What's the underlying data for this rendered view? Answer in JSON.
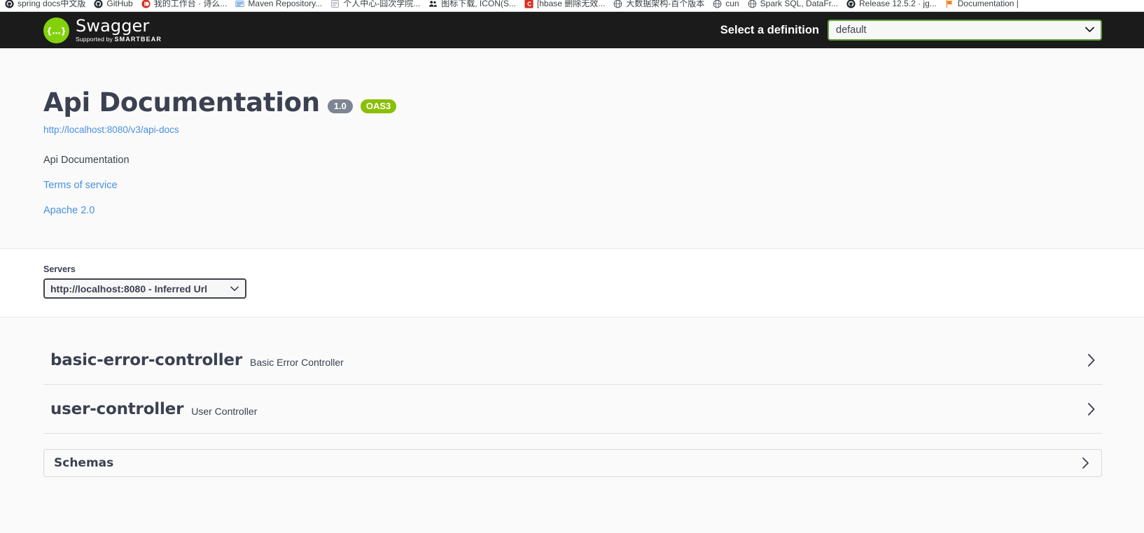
{
  "browser": {
    "bookmarks": [
      {
        "label": "spring docs中文版",
        "icon": "github-icon",
        "color": "#24292e"
      },
      {
        "label": "GitHub",
        "icon": "github-icon",
        "color": "#24292e"
      },
      {
        "label": "我的工作台 · 诗么...",
        "icon": "record-icon",
        "color": "#d93025"
      },
      {
        "label": "Maven Repository...",
        "icon": "book-icon",
        "color": "#4a90d9"
      },
      {
        "label": "个人中心-囧次学院...",
        "icon": "page-icon",
        "color": "#9aa0a6"
      },
      {
        "label": "图标下载, ICON(S...",
        "icon": "people-icon",
        "color": "#202124"
      },
      {
        "label": "[hbase 删除无效...",
        "icon": "csdn-icon",
        "color": "#d93025"
      },
      {
        "label": "大数据架构-百个版本",
        "icon": "globe-icon",
        "color": "#5f6368"
      },
      {
        "label": "cun",
        "icon": "globe-icon",
        "color": "#5f6368"
      },
      {
        "label": "Spark SQL, DataFr...",
        "icon": "globe-icon",
        "color": "#5f6368"
      },
      {
        "label": "Release 12.5.2 · jg...",
        "icon": "github-icon",
        "color": "#24292e"
      },
      {
        "label": "Documentation |",
        "icon": "flag-icon",
        "color": "#f5811f"
      }
    ]
  },
  "topbar": {
    "logo_word": "Swagger",
    "logo_sub_prefix": "Supported by",
    "logo_sub_brand": "SMARTBEAR",
    "logo_glyph": "{...}",
    "definition_label": "Select a definition",
    "definition_value": "default",
    "definition_options": [
      "default"
    ],
    "accent_green": "#83d10c",
    "select_border": "#62a03f",
    "bar_background": "#1b1b1b"
  },
  "info": {
    "title": "Api Documentation",
    "version_badge": "1.0",
    "oas_badge": "OAS3",
    "docs_url": "http://localhost:8080/v3/api-docs",
    "description": "Api Documentation",
    "terms_link": "Terms of service",
    "license_link": "Apache 2.0",
    "link_color": "#4990e2",
    "version_badge_color": "#7d8492",
    "oas_badge_color": "#89bf04"
  },
  "servers": {
    "label": "Servers",
    "value": "http://localhost:8080 - Inferred Url",
    "options": [
      "http://localhost:8080 - Inferred Url"
    ]
  },
  "tags": [
    {
      "name": "basic-error-controller",
      "description": "Basic Error Controller"
    },
    {
      "name": "user-controller",
      "description": "User Controller"
    }
  ],
  "schemas": {
    "title": "Schemas"
  }
}
